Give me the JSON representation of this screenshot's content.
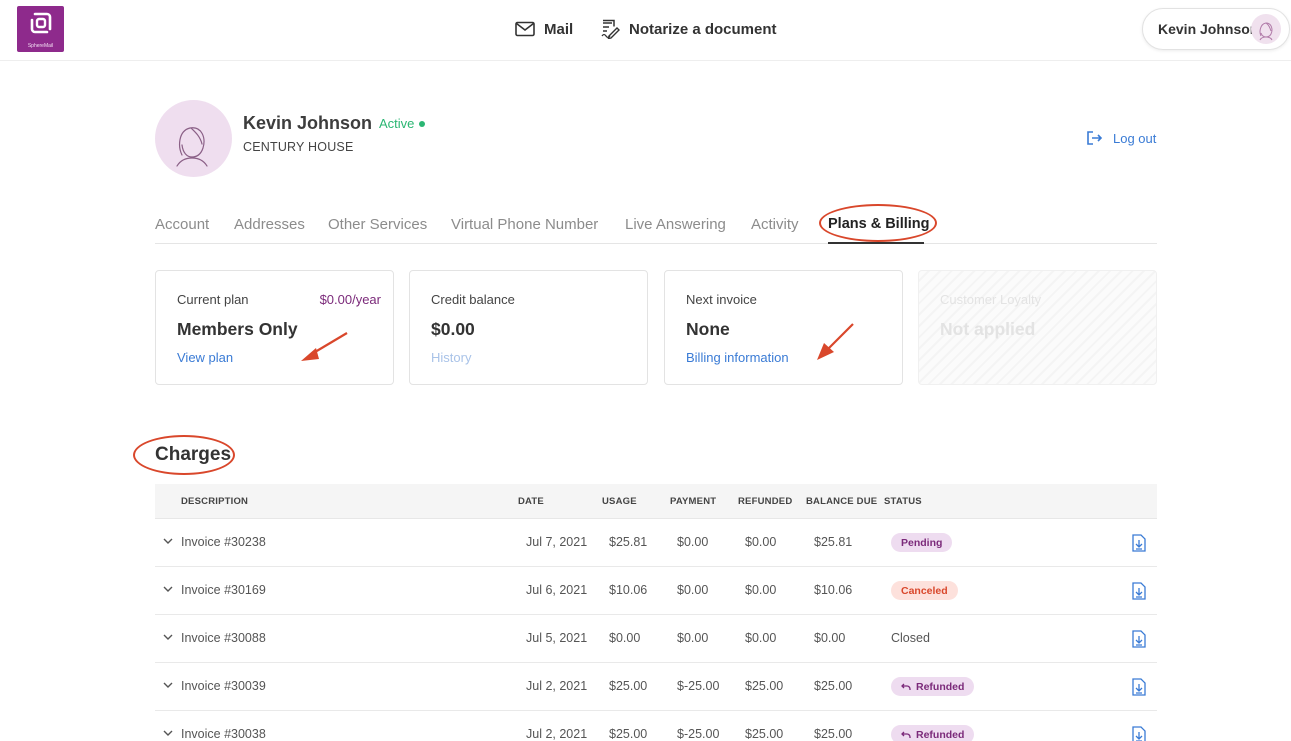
{
  "brand": {
    "name": "SphereMail",
    "color": "#8e2a8c"
  },
  "topnav": {
    "mail_label": "Mail",
    "notarize_label": "Notarize a document"
  },
  "user": {
    "name": "Kevin Johnson"
  },
  "profile": {
    "name": "Kevin Johnson",
    "status": "Active",
    "company": "CENTURY HOUSE",
    "logout_label": "Log out"
  },
  "tabs": [
    {
      "label": "Account"
    },
    {
      "label": "Addresses"
    },
    {
      "label": "Other Services"
    },
    {
      "label": "Virtual Phone Number"
    },
    {
      "label": "Live Answering"
    },
    {
      "label": "Activity"
    },
    {
      "label": "Plans & Billing",
      "active": true
    }
  ],
  "cards": {
    "plan": {
      "label": "Current plan",
      "price": "$0.00/year",
      "value": "Members Only",
      "link": "View plan"
    },
    "credit": {
      "label": "Credit balance",
      "value": "$0.00",
      "link": "History"
    },
    "invoice": {
      "label": "Next invoice",
      "value": "None",
      "link": "Billing information"
    },
    "loyalty": {
      "label": "Customer Loyalty",
      "value": "Not applied"
    }
  },
  "charges": {
    "title": "Charges",
    "columns": [
      "DESCRIPTION",
      "DATE",
      "USAGE",
      "PAYMENT",
      "REFUNDED",
      "BALANCE DUE",
      "STATUS"
    ],
    "rows": [
      {
        "description": "Invoice #30238",
        "date": "Jul 7, 2021",
        "usage": "$25.81",
        "payment": "$0.00",
        "refunded": "$0.00",
        "balance": "$25.81",
        "status": "Pending"
      },
      {
        "description": "Invoice #30169",
        "date": "Jul 6, 2021",
        "usage": "$10.06",
        "payment": "$0.00",
        "refunded": "$0.00",
        "balance": "$10.06",
        "status": "Canceled"
      },
      {
        "description": "Invoice #30088",
        "date": "Jul 5, 2021",
        "usage": "$0.00",
        "payment": "$0.00",
        "refunded": "$0.00",
        "balance": "$0.00",
        "status": "Closed"
      },
      {
        "description": "Invoice #30039",
        "date": "Jul 2, 2021",
        "usage": "$25.00",
        "payment": "$-25.00",
        "refunded": "$25.00",
        "balance": "$25.00",
        "status": "Refunded"
      },
      {
        "description": "Invoice #30038",
        "date": "Jul 2, 2021",
        "usage": "$25.00",
        "payment": "$-25.00",
        "refunded": "$25.00",
        "balance": "$25.00",
        "status": "Refunded"
      }
    ]
  },
  "colors": {
    "accent_purple": "#7b2a7a",
    "link_blue": "#3a7bd5",
    "active_green": "#2bb673",
    "annotation_red": "#d9472b"
  }
}
